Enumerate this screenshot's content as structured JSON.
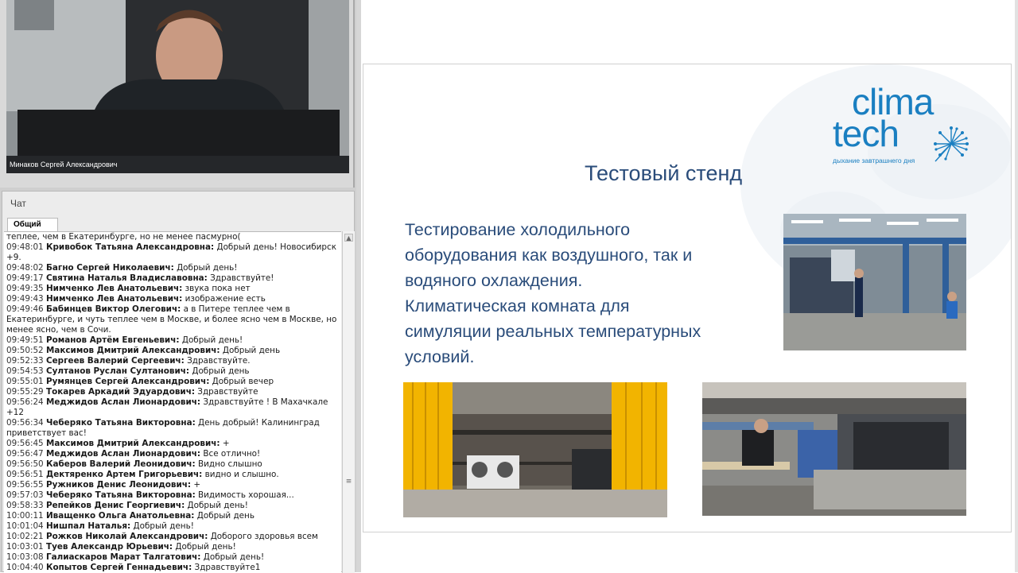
{
  "video": {
    "presenter_name": "Минаков Сергей Александрович"
  },
  "chat": {
    "title": "Чат",
    "tab_label": "Общий",
    "messages": [
      {
        "time": "",
        "author": "",
        "text": "теплее, чем в Екатеринбурге, но не менее пасмурно("
      },
      {
        "time": "09:48:01",
        "author": "Кривобок Татьяна Александровна:",
        "text": "Добрый день! Новосибирск +9."
      },
      {
        "time": "09:48:02",
        "author": "Багно Сергей Николаевич:",
        "text": "Добрый день!"
      },
      {
        "time": "09:49:17",
        "author": "Святина Наталья Владиславовна:",
        "text": "Здравствуйте!"
      },
      {
        "time": "09:49:35",
        "author": "Нимченко Лев Анатольевич:",
        "text": "звука пока нет"
      },
      {
        "time": "09:49:43",
        "author": "Нимченко Лев Анатольевич:",
        "text": "изображение есть"
      },
      {
        "time": "09:49:46",
        "author": "Бабинцев Виктор Олегович:",
        "text": "а в Питере теплее чем в Екатеринбурге, и чуть теплее чем в Москве, и более ясно чем в Москве, но менее ясно, чем в Сочи."
      },
      {
        "time": "09:49:51",
        "author": "Романов Артём Евгеньевич:",
        "text": "Добрый день!"
      },
      {
        "time": "09:50:52",
        "author": "Максимов Дмитрий Александрович:",
        "text": "Добрый день"
      },
      {
        "time": "09:52:33",
        "author": "Сергеев Валерий Сергеевич:",
        "text": "Здравствуйте."
      },
      {
        "time": "09:54:53",
        "author": "Султанов Руслан Султанович:",
        "text": " Добрый день"
      },
      {
        "time": "09:55:01",
        "author": "Румянцев Сергей Александрович:",
        "text": "Добрый вечер"
      },
      {
        "time": "09:55:29",
        "author": "Токарев Аркадий Эдуардович:",
        "text": "Здравствуйте"
      },
      {
        "time": "09:56:24",
        "author": "Меджидов Аслан Лионардович:",
        "text": "Здравствуйте ! В Махачкале +12"
      },
      {
        "time": "09:56:34",
        "author": "Чеберяко Татьяна Викторовна:",
        "text": "День добрый! Калининград приветствует вас!"
      },
      {
        "time": "09:56:45",
        "author": "Максимов Дмитрий Александрович:",
        "text": "+"
      },
      {
        "time": "09:56:47",
        "author": "Меджидов Аслан Лионардович:",
        "text": "Все отлично!"
      },
      {
        "time": "09:56:50",
        "author": "Каберов Валерий Леонидович:",
        "text": "Видно слышно"
      },
      {
        "time": "09:56:51",
        "author": "Дектяренко Артем Григорьевич:",
        "text": "видно и слышно."
      },
      {
        "time": "09:56:55",
        "author": "Ружников Денис Леонидович:",
        "text": "+"
      },
      {
        "time": "09:57:03",
        "author": "Чеберяко Татьяна Викторовна:",
        "text": "Видимость хорошая..."
      },
      {
        "time": "09:58:33",
        "author": "Репейков Денис Георгиевич:",
        "text": "Добрый день!"
      },
      {
        "time": "10:00:11",
        "author": "Иващенко Ольга Анатольевна:",
        "text": "Добрый день"
      },
      {
        "time": "10:01:04",
        "author": "Нишпал Наталья:",
        "text": "Добрый день!"
      },
      {
        "time": "10:02:21",
        "author": "Рожков Николай Александрович:",
        "text": "Доборого здоровья всем"
      },
      {
        "time": "10:03:01",
        "author": "Туев Александр Юрьевич:",
        "text": "Добрый день!"
      },
      {
        "time": "10:03:08",
        "author": "Галиаскаров Марат Талгатович:",
        "text": "Добрый день!"
      },
      {
        "time": "10:04:40",
        "author": "Копытов Сергей Геннадьевич:",
        "text": "Здравствуйте1"
      }
    ]
  },
  "slide": {
    "logo_line1": "clima",
    "logo_line2": "tech",
    "logo_tagline": "дыхание завтрашнего дня",
    "title": "Тестовый стенд",
    "body": "Тестирование холодильного оборудования как воздушного, так и водяного охлаждения. Климатическая комната для симуляции реальных температурных условий."
  },
  "colors": {
    "slide_text": "#2a4c7a",
    "logo_blue": "#1a7fc1",
    "curtain_yellow": "#f2b400"
  }
}
